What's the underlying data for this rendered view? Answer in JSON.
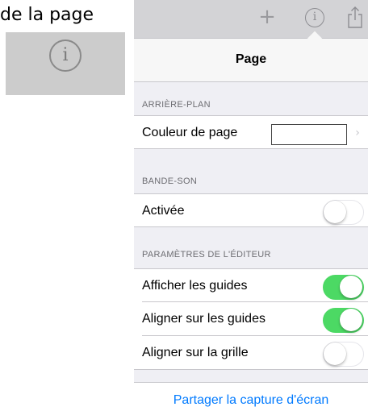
{
  "caption": "de la page",
  "zoom_icon": {
    "icon": "info-icon",
    "glyph": "i"
  },
  "toolbar": {
    "add_glyph": "+",
    "info_glyph": "i",
    "icons": [
      "add-icon",
      "info-icon",
      "share-icon"
    ]
  },
  "nav": {
    "title": "Page"
  },
  "sections": {
    "background": {
      "header": "ARRIÈRE-PLAN",
      "page_color_label": "Couleur de page",
      "page_color_value": "#ffffff",
      "chevron": "›"
    },
    "soundtrack": {
      "header": "BANDE-SON",
      "enabled_label": "Activée",
      "enabled": false
    },
    "editor": {
      "header": "PARAMÈTRES DE L'ÉDITEUR",
      "show_guides_label": "Afficher les guides",
      "show_guides": true,
      "snap_guides_label": "Aligner sur les guides",
      "snap_guides": true,
      "snap_grid_label": "Aligner sur la grille",
      "snap_grid": false
    }
  },
  "share_button": "Partager la capture d'écran",
  "colors": {
    "accent": "#007aff",
    "switch_on": "#4cd964",
    "toolbar_bg": "#d3d3d6",
    "grouped_bg": "#efeff4"
  }
}
